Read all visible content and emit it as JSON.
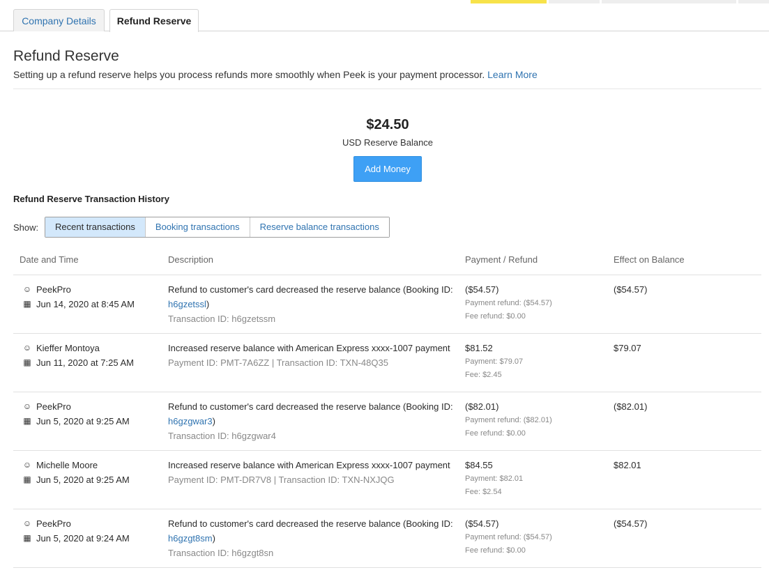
{
  "top_bar": {
    "colors": [
      "#f7e24a",
      "#eeeeee",
      "#eeeeee",
      "#eeeeee"
    ]
  },
  "tabs": [
    {
      "label": "Company Details"
    },
    {
      "label": "Refund Reserve"
    }
  ],
  "page": {
    "title": "Refund Reserve",
    "intro": "Setting up a refund reserve helps you process refunds more smoothly when Peek is your payment processor.",
    "learn_more": "Learn More"
  },
  "balance": {
    "amount": "$24.50",
    "label": "USD Reserve Balance",
    "add_money": "Add Money"
  },
  "history": {
    "title": "Refund Reserve Transaction History",
    "show_label": "Show:",
    "filters": [
      "Recent transactions",
      "Booking transactions",
      "Reserve balance transactions"
    ],
    "active_filter": "Recent transactions",
    "columns": [
      "Date and Time",
      "Description",
      "Payment / Refund",
      "Effect on Balance"
    ],
    "rows": [
      {
        "user": "PeekPro",
        "date": "Jun 14, 2020 at 8:45 AM",
        "desc_prefix": "Refund to customer's card decreased the reserve balance (Booking ID: ",
        "desc_link": "h6gzetssl",
        "desc_suffix": ")",
        "desc_sub": "Transaction ID: h6gzetssm",
        "pay_main": "($54.57)",
        "pay_line1": "Payment refund: ($54.57)",
        "pay_line2": "Fee refund: $0.00",
        "effect": "($54.57)",
        "positive": false
      },
      {
        "user": "Kieffer Montoya",
        "date": "Jun 11, 2020 at 7:25 AM",
        "desc_prefix": "Increased reserve balance with American Express xxxx-1007 payment",
        "desc_link": "",
        "desc_suffix": "",
        "desc_sub": "Payment ID: PMT-7A6ZZ | Transaction ID: TXN-48Q35",
        "pay_main": "$81.52",
        "pay_line1": "Payment: $79.07",
        "pay_line2": "Fee: $2.45",
        "effect": "$79.07",
        "positive": true
      },
      {
        "user": "PeekPro",
        "date": "Jun 5, 2020 at 9:25 AM",
        "desc_prefix": "Refund to customer's card decreased the reserve balance (Booking ID: ",
        "desc_link": "h6gzgwar3",
        "desc_suffix": ")",
        "desc_sub": "Transaction ID: h6gzgwar4",
        "pay_main": "($82.01)",
        "pay_line1": "Payment refund: ($82.01)",
        "pay_line2": "Fee refund: $0.00",
        "effect": "($82.01)",
        "positive": false
      },
      {
        "user": "Michelle Moore",
        "date": "Jun 5, 2020 at 9:25 AM",
        "desc_prefix": "Increased reserve balance with American Express xxxx-1007 payment",
        "desc_link": "",
        "desc_suffix": "",
        "desc_sub": "Payment ID: PMT-DR7V8 | Transaction ID: TXN-NXJQG",
        "pay_main": "$84.55",
        "pay_line1": "Payment: $82.01",
        "pay_line2": "Fee: $2.54",
        "effect": "$82.01",
        "positive": true
      },
      {
        "user": "PeekPro",
        "date": "Jun 5, 2020 at 9:24 AM",
        "desc_prefix": "Refund to customer's card decreased the reserve balance (Booking ID: ",
        "desc_link": "h6gzgt8sm",
        "desc_suffix": ")",
        "desc_sub": "Transaction ID: h6gzgt8sn",
        "pay_main": "($54.57)",
        "pay_line1": "Payment refund: ($54.57)",
        "pay_line2": "Fee refund: $0.00",
        "effect": "($54.57)",
        "positive": false
      }
    ]
  },
  "icons": {
    "user": "user-icon",
    "date": "calendar-icon"
  },
  "colors": {
    "link": "#2f73b0",
    "primary_button": "#3ea0f5",
    "positive": "#4caf50",
    "active_filter_bg": "#d3e8fb"
  }
}
